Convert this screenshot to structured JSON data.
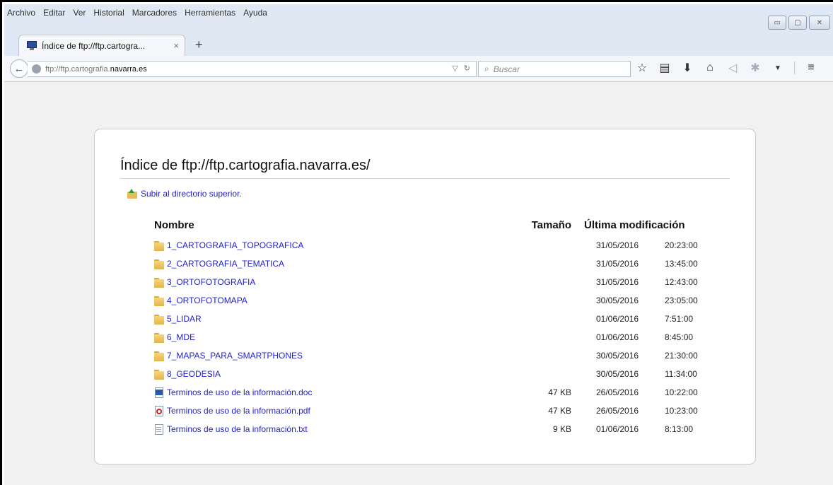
{
  "menu": {
    "items": [
      {
        "label": "Archivo"
      },
      {
        "label": "Editar"
      },
      {
        "label": "Ver"
      },
      {
        "label": "Historial"
      },
      {
        "label": "Marcadores"
      },
      {
        "label": "Herramientas"
      },
      {
        "label": "Ayuda"
      }
    ]
  },
  "window_controls": {
    "minimize": "▭",
    "maximize": "▢",
    "close": "✕"
  },
  "tab": {
    "title": "Índice de ftp://ftp.cartogra...",
    "close": "×",
    "new_tab": "+"
  },
  "nav": {
    "url_prefix": "ftp://ftp.cartografia.",
    "url_domain": "navarra.es",
    "search_placeholder": "Buscar"
  },
  "page": {
    "heading": "Índice de ftp://ftp.cartografia.navarra.es/",
    "parent_link": "Subir al directorio superior.",
    "columns": {
      "name": "Nombre",
      "size": "Tamaño",
      "modified": "Última modificación"
    },
    "rows": [
      {
        "icon": "folder",
        "name": "1_CARTOGRAFIA_TOPOGRAFICA",
        "size": "",
        "date": "31/05/2016",
        "time": "20:23:00"
      },
      {
        "icon": "folder",
        "name": "2_CARTOGRAFIA_TEMATICA",
        "size": "",
        "date": "31/05/2016",
        "time": "13:45:00"
      },
      {
        "icon": "folder",
        "name": "3_ORTOFOTOGRAFIA",
        "size": "",
        "date": "31/05/2016",
        "time": "12:43:00"
      },
      {
        "icon": "folder",
        "name": "4_ORTOFOTOMAPA",
        "size": "",
        "date": "30/05/2016",
        "time": "23:05:00"
      },
      {
        "icon": "folder",
        "name": "5_LIDAR",
        "size": "",
        "date": "01/06/2016",
        "time": "7:51:00"
      },
      {
        "icon": "folder",
        "name": "6_MDE",
        "size": "",
        "date": "01/06/2016",
        "time": "8:45:00"
      },
      {
        "icon": "folder",
        "name": "7_MAPAS_PARA_SMARTPHONES",
        "size": "",
        "date": "30/05/2016",
        "time": "21:30:00"
      },
      {
        "icon": "folder",
        "name": "8_GEODESIA",
        "size": "",
        "date": "30/05/2016",
        "time": "11:34:00"
      },
      {
        "icon": "doc",
        "name": "Terminos de uso de la información.doc",
        "size": "47 KB",
        "date": "26/05/2016",
        "time": "10:22:00"
      },
      {
        "icon": "pdf",
        "name": "Terminos de uso de la información.pdf",
        "size": "47 KB",
        "date": "26/05/2016",
        "time": "10:23:00"
      },
      {
        "icon": "txt",
        "name": "Terminos de uso de la información.txt",
        "size": "9 KB",
        "date": "01/06/2016",
        "time": "8:13:00"
      }
    ]
  },
  "colors": {
    "link": "#2222cc",
    "menubar_bg": "#dfe8f3",
    "page_bg": "#f1f1f1"
  }
}
